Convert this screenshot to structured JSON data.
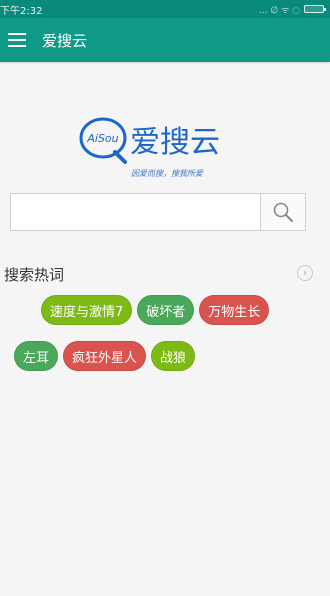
{
  "status_bar": {
    "time": "下午2:32",
    "signal_text": "... ∅ ᯤ ◌"
  },
  "app_bar": {
    "title": "爱搜云"
  },
  "logo": {
    "brand_circle_text": "AiSou",
    "brand_text": "爱搜云",
    "tagline": "因爱而搜，搜我所爱",
    "colors": {
      "primary": "#1e66c8"
    }
  },
  "search": {
    "value": "",
    "placeholder": ""
  },
  "hot": {
    "title": "搜索热词",
    "tags_row1": [
      {
        "label": "速度与激情7",
        "color": "#7dba16"
      },
      {
        "label": "破坏者",
        "color": "#4aa85a"
      },
      {
        "label": "万物生长",
        "color": "#d9534f"
      }
    ],
    "tags_row2": [
      {
        "label": "左耳",
        "color": "#4aa85a"
      },
      {
        "label": "疯狂外星人",
        "color": "#d9534f"
      },
      {
        "label": "战狼",
        "color": "#7dba16"
      }
    ]
  },
  "colors": {
    "status_bar": "#0a8a7a",
    "app_bar": "#0e9a87",
    "background": "#f5f5f5"
  }
}
